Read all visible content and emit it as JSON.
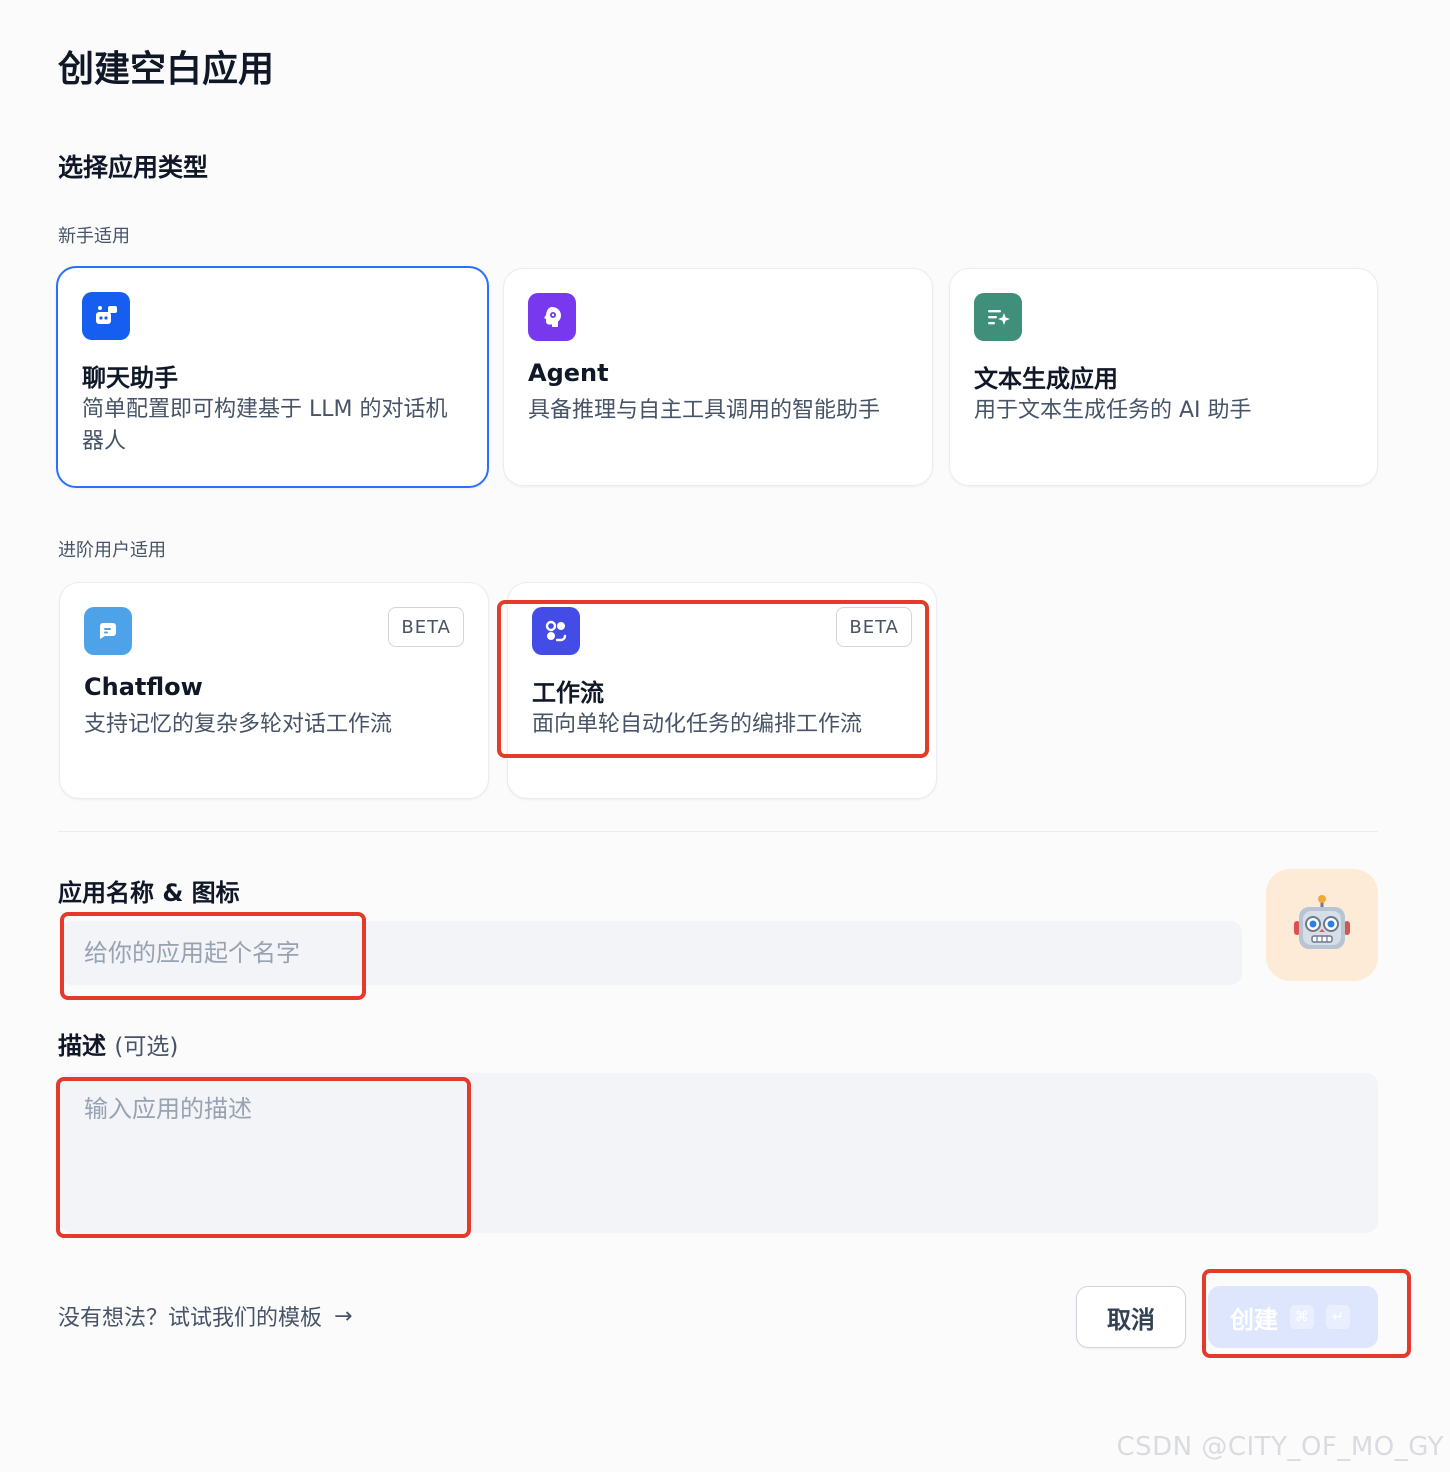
{
  "dialog": {
    "title": "创建空白应用",
    "section_title": "选择应用类型"
  },
  "groups": {
    "beginner": "新手适用",
    "advanced": "进阶用户适用"
  },
  "cards": {
    "chat": {
      "title": "聊天助手",
      "desc": "简单配置即可构建基于 LLM 的对话机器人",
      "icon": "chat-bot-icon",
      "color": "#155eef"
    },
    "agent": {
      "title": "Agent",
      "desc": "具备推理与自主工具调用的智能助手",
      "icon": "agent-brain-icon",
      "color": "#7839ee"
    },
    "text": {
      "title": "文本生成应用",
      "desc": "用于文本生成任务的 AI 助手",
      "icon": "text-sparkle-icon",
      "color": "#3f8f7a"
    },
    "chatflow": {
      "title": "Chatflow",
      "desc": "支持记忆的复杂多轮对话工作流",
      "badge": "BETA",
      "icon": "chatflow-icon",
      "color": "#4ea3e8"
    },
    "workflow": {
      "title": "工作流",
      "desc": "面向单轮自动化任务的编排工作流",
      "badge": "BETA",
      "icon": "workflow-icon",
      "color": "#444ce7"
    }
  },
  "form": {
    "name_label": "应用名称 & 图标",
    "name_placeholder": "给你的应用起个名字",
    "name_value": "",
    "avatar_emoji": "🤖",
    "desc_label": "描述",
    "desc_optional": "(可选)",
    "desc_placeholder": "输入应用的描述"
  },
  "footer": {
    "template_link": "没有想法？试试我们的模板",
    "arrow": "→",
    "cancel": "取消",
    "create": "创建",
    "shortcut_cmd": "⌘",
    "shortcut_enter": "↵"
  },
  "watermark": "CSDN @CITY_OF_MO_GY",
  "colors": {
    "selected_border": "#2970ff",
    "annotation_red": "#e33a2c",
    "create_disabled": "#dde6fd"
  }
}
